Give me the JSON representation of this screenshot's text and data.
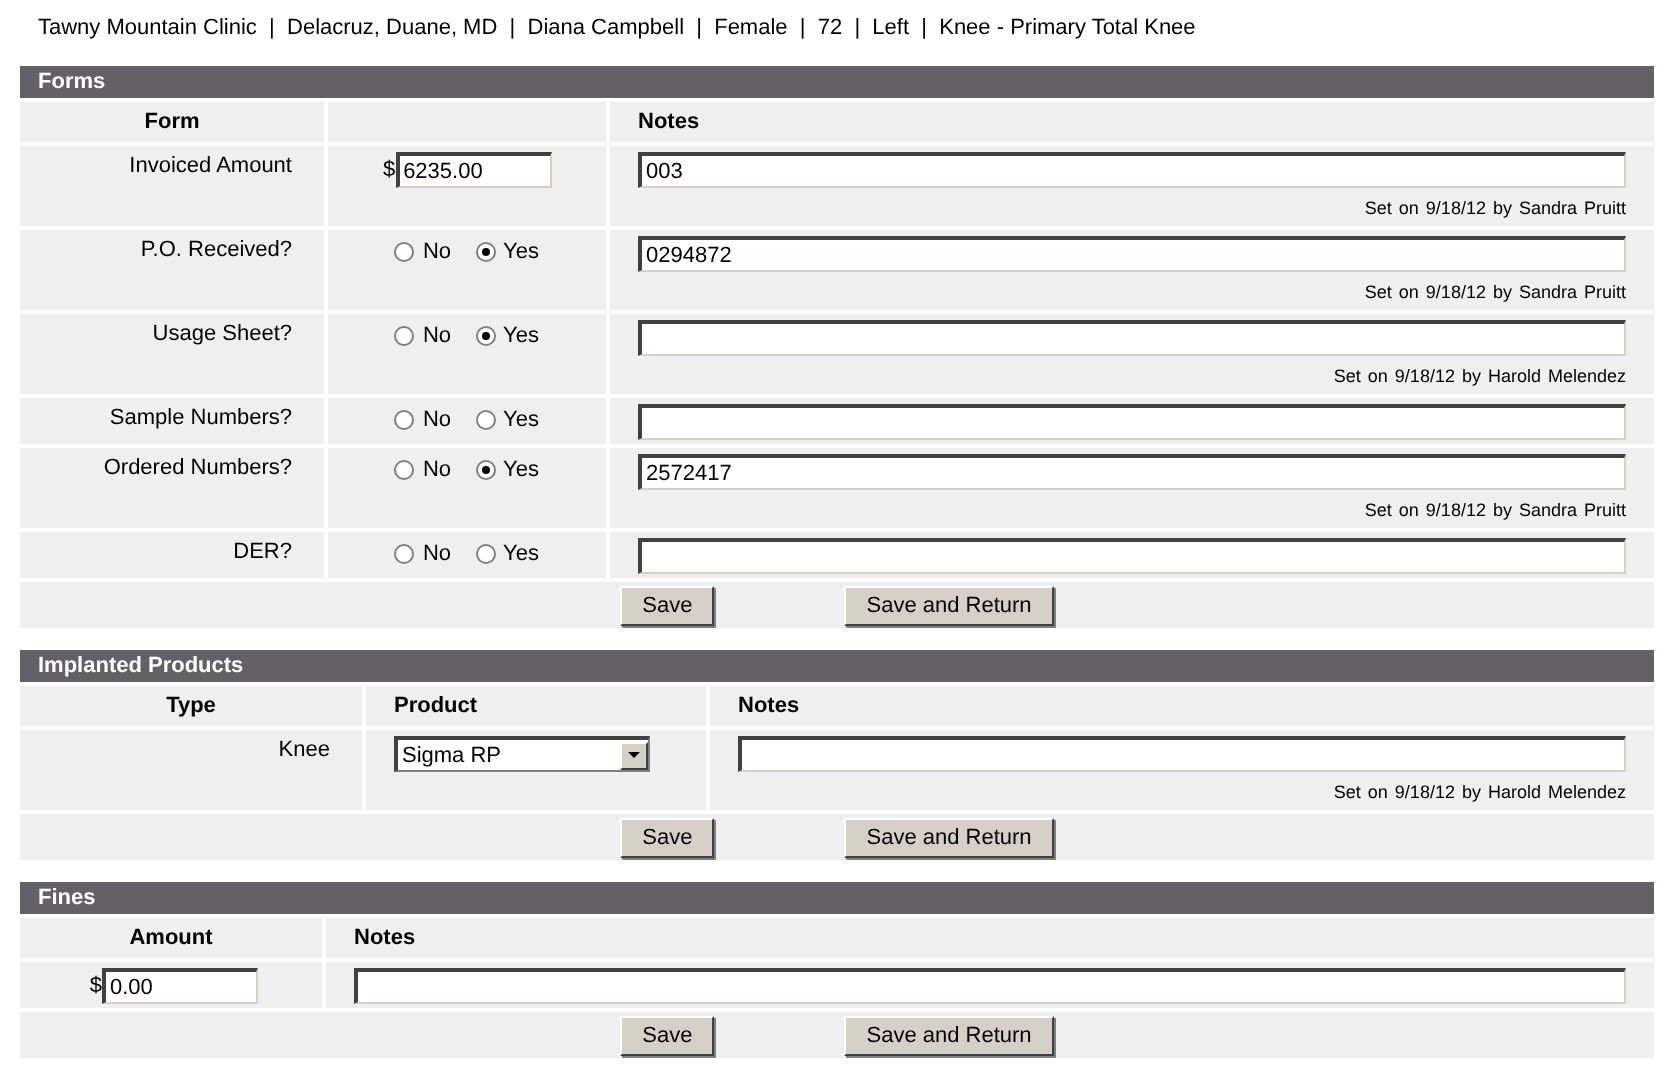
{
  "header": "Tawny Mountain Clinic  |  Delacruz, Duane, MD  |  Diana Campbell  |  Female  |  72  |  Left  |  Knee - Primary Total Knee",
  "forms": {
    "title": "Forms",
    "columns": {
      "form": "Form",
      "notes": "Notes"
    },
    "rows": [
      {
        "kind": "amount",
        "label": "Invoiced Amount",
        "currency": "$",
        "amount": "6235.00",
        "note": "003",
        "meta": "Set on 9/18/12 by  Sandra Pruitt"
      },
      {
        "kind": "yesno",
        "label": "P.O. Received?",
        "options": [
          {
            "label": "No",
            "selected": false
          },
          {
            "label": "Yes",
            "selected": true
          }
        ],
        "note": "0294872",
        "meta": "Set on 9/18/12 by  Sandra Pruitt"
      },
      {
        "kind": "yesno",
        "label": "Usage Sheet?",
        "options": [
          {
            "label": "No",
            "selected": false
          },
          {
            "label": "Yes",
            "selected": true
          }
        ],
        "meta": "Set on 9/18/12 by  Harold Melendez"
      },
      {
        "kind": "yesno",
        "label": "Sample Numbers?",
        "options": [
          {
            "label": "No",
            "selected": false
          },
          {
            "label": "Yes",
            "selected": false
          }
        ]
      },
      {
        "kind": "yesno",
        "label": "Ordered Numbers?",
        "options": [
          {
            "label": "No",
            "selected": false
          },
          {
            "label": "Yes",
            "selected": true
          }
        ],
        "note": "2572417",
        "meta": "Set on 9/18/12 by  Sandra Pruitt"
      },
      {
        "kind": "yesno",
        "label": "DER?",
        "options": [
          {
            "label": "No",
            "selected": false
          },
          {
            "label": "Yes",
            "selected": false
          }
        ]
      }
    ],
    "buttons": [
      "Save",
      "Save and Return"
    ]
  },
  "implanted": {
    "title": "Implanted Products",
    "columns": {
      "type": "Type",
      "product": "Product",
      "notes": "Notes"
    },
    "rows": [
      {
        "type": "Knee",
        "product": "Sigma RP",
        "meta": "Set on 9/18/12 by  Harold Melendez"
      }
    ],
    "buttons": [
      "Save",
      "Save and Return"
    ]
  },
  "fines": {
    "title": "Fines",
    "columns": {
      "amount": "Amount",
      "notes": "Notes"
    },
    "rows": [
      {
        "currency": "$",
        "amount": "0.00"
      }
    ],
    "buttons": [
      "Save",
      "Save and Return"
    ]
  }
}
